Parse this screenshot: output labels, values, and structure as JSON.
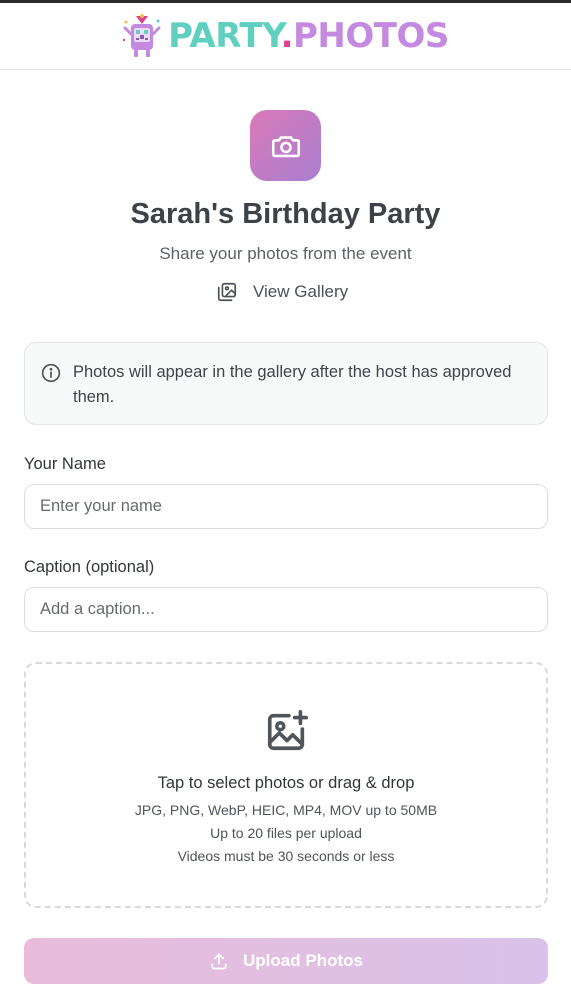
{
  "brand": {
    "part1": "PARTY",
    "dot": ".",
    "part2": "PHOTOS",
    "logo_icon": "party-mascot-icon"
  },
  "colors": {
    "brand_teal": "#5fd0bf",
    "brand_pink": "#e0418f",
    "brand_purple": "#c48ae0",
    "accent_gradient_start": "#d97ab7",
    "accent_gradient_end": "#a97ed0",
    "button_gradient_start": "#e9bcda",
    "button_gradient_end": "#d8c2e9"
  },
  "event": {
    "icon": "camera-icon",
    "title": "Sarah's Birthday Party",
    "subtitle": "Share your photos from the event"
  },
  "gallery_link": {
    "icon": "gallery-icon",
    "label": "View Gallery"
  },
  "notice": {
    "icon": "info-icon",
    "text": "Photos will appear in the gallery after the host has approved them."
  },
  "form": {
    "name_label": "Your Name",
    "name_placeholder": "Enter your name",
    "name_value": "",
    "caption_label": "Caption (optional)",
    "caption_placeholder": "Add a caption...",
    "caption_value": ""
  },
  "dropzone": {
    "icon": "add-image-icon",
    "title": "Tap to select photos or drag & drop",
    "formats": "JPG, PNG, WebP, HEIC, MP4, MOV up to 50MB",
    "limit": "Up to 20 files per upload",
    "video_limit": "Videos must be 30 seconds or less"
  },
  "upload_button": {
    "icon": "upload-icon",
    "label": "Upload Photos",
    "disabled": true
  }
}
